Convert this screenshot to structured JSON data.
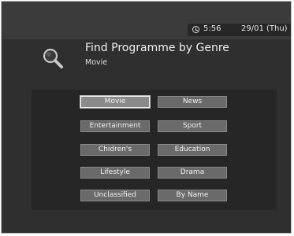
{
  "header": {
    "time": "5:56",
    "date": "29/01 (Thu)"
  },
  "screen": {
    "title": "Find Programme by Genre",
    "subtitle": "Movie"
  },
  "genres": [
    {
      "label": "Movie",
      "selected": true
    },
    {
      "label": "News"
    },
    {
      "label": "Entertainment"
    },
    {
      "label": "Sport"
    },
    {
      "label": "Chidren's"
    },
    {
      "label": "Education"
    },
    {
      "label": "Lifestyle"
    },
    {
      "label": "Drama"
    },
    {
      "label": "Unclassified"
    },
    {
      "label": "By Name"
    }
  ],
  "colors": {
    "background": "#2f2f2f",
    "panel": "#262626",
    "button": "#6a6a6a",
    "button_selected": "#8a8a8a"
  },
  "icons": [
    "clock-icon",
    "search-icon"
  ]
}
